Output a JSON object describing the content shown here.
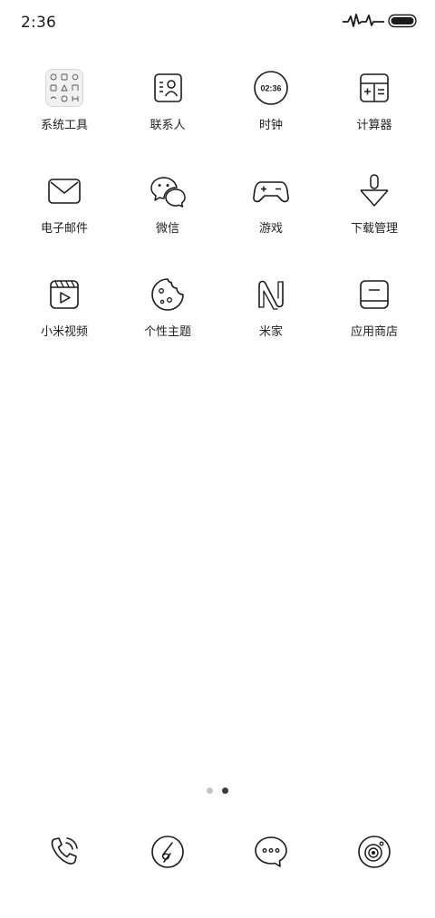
{
  "status_bar": {
    "time": "2:36",
    "icons": [
      "pulse-signal-icon",
      "battery-icon"
    ]
  },
  "apps": [
    {
      "label": "系统工具",
      "icon": "system-tools-folder-icon"
    },
    {
      "label": "联系人",
      "icon": "contacts-icon"
    },
    {
      "label": "时钟",
      "icon": "clock-icon",
      "icon_text": "02:36"
    },
    {
      "label": "计算器",
      "icon": "calculator-icon"
    },
    {
      "label": "电子邮件",
      "icon": "email-icon"
    },
    {
      "label": "微信",
      "icon": "wechat-icon"
    },
    {
      "label": "游戏",
      "icon": "gamepad-icon"
    },
    {
      "label": "下载管理",
      "icon": "download-icon"
    },
    {
      "label": "小米视频",
      "icon": "video-icon"
    },
    {
      "label": "个性主题",
      "icon": "theme-icon"
    },
    {
      "label": "米家",
      "icon": "mijia-icon"
    },
    {
      "label": "应用商店",
      "icon": "app-store-icon"
    }
  ],
  "page_indicator": {
    "pages": 2,
    "current": 2
  },
  "dock": [
    {
      "icon": "phone-icon"
    },
    {
      "icon": "browser-icon"
    },
    {
      "icon": "messages-icon"
    },
    {
      "icon": "camera-icon"
    }
  ]
}
